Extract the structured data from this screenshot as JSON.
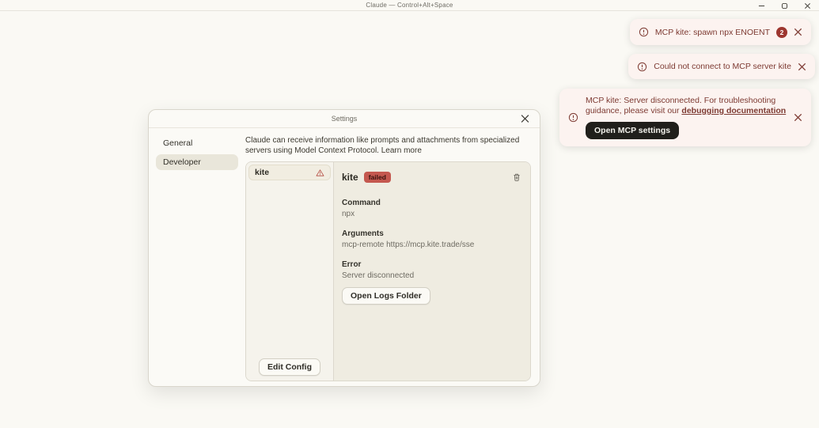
{
  "window": {
    "title": "Claude — Control+Alt+Space"
  },
  "toasts": {
    "spawn_error": {
      "text": "MCP kite: spawn npx ENOENT",
      "count": "2"
    },
    "connect_error": {
      "text": "Could not connect to MCP server kite"
    },
    "disconnected": {
      "text": "MCP kite: Server disconnected. For troubleshooting guidance, please visit our ",
      "link_text": "debugging documentation",
      "button_label": "Open MCP settings"
    }
  },
  "settings_dialog": {
    "title": "Settings",
    "sidebar": {
      "items": [
        {
          "label": "General"
        },
        {
          "label": "Developer"
        }
      ]
    },
    "description": "Claude can receive information like prompts and attachments from specialized servers using Model Context Protocol. ",
    "learn_more": "Learn more",
    "servers": {
      "list": [
        {
          "name": "kite"
        }
      ],
      "edit_config_label": "Edit Config"
    },
    "detail": {
      "name": "kite",
      "status_badge": "failed",
      "command_label": "Command",
      "command_value": "npx",
      "arguments_label": "Arguments",
      "arguments_value": "mcp-remote https://mcp.kite.trade/sse",
      "error_label": "Error",
      "error_value": "Server disconnected",
      "open_logs_label": "Open Logs Folder"
    }
  },
  "colors": {
    "page_bg": "#faf9f4",
    "toast_bg": "#fcf3f0",
    "toast_text": "#7d3a32",
    "badge_bg": "#9d362f",
    "failed_badge_bg": "#c4584f",
    "dialog_bg": "#fbfaf6",
    "sidebar_selected_bg": "#e9e6da",
    "panel_list_bg": "#f5f3ec",
    "panel_detail_bg": "#efece1",
    "dark_button_bg": "#201f1b"
  }
}
